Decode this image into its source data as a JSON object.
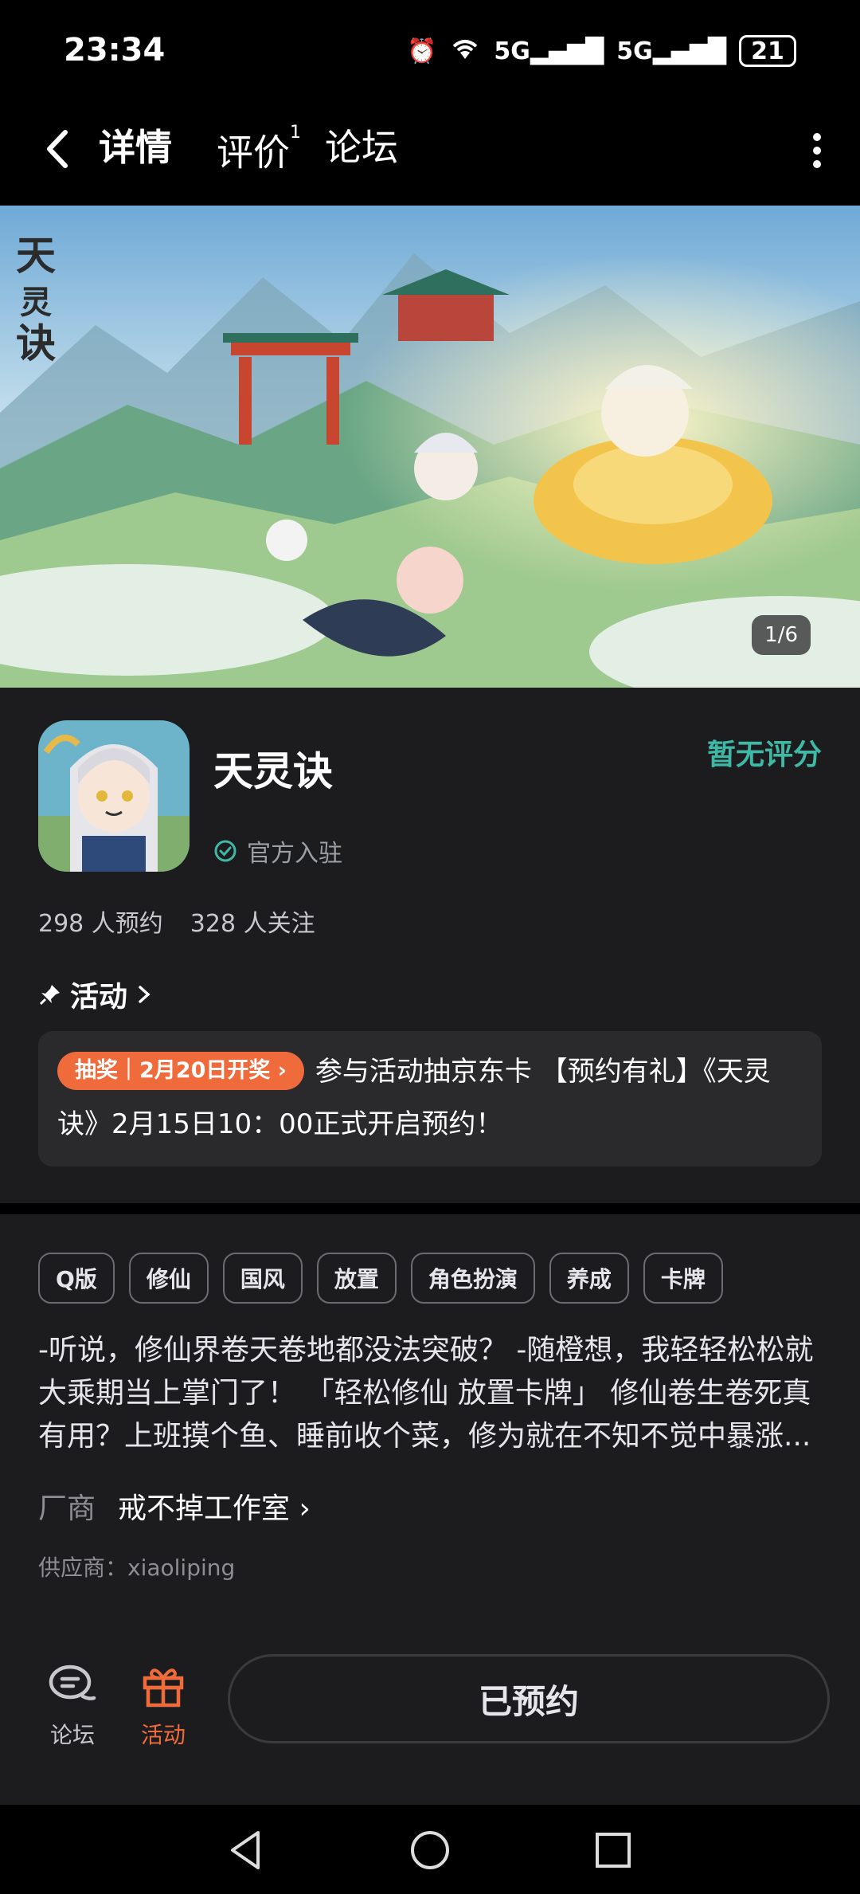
{
  "status": {
    "time": "23:34",
    "net1": "5G",
    "net2": "5G",
    "battery": "21"
  },
  "nav": {
    "tabs": [
      {
        "label": "详情"
      },
      {
        "label": "评价",
        "badge": "1"
      },
      {
        "label": "论坛"
      }
    ]
  },
  "banner": {
    "counter": "1/6",
    "logo_text": "天灵诀"
  },
  "app": {
    "name": "天灵诀",
    "verified_label": "官方入驻",
    "rating": "暂无评分",
    "reservations": "298 人预约",
    "followers": "328 人关注"
  },
  "activity": {
    "title": "活动",
    "badge": "抽奖｜2月20日开奖",
    "text": "参与活动抽京东卡 【预约有礼】《天灵诀》2月15日10：00正式开启预约！"
  },
  "tags": [
    "Q版",
    "修仙",
    "国风",
    "放置",
    "角色扮演",
    "养成",
    "卡牌"
  ],
  "description": "-听说，修仙界卷天卷地都没法突破？ -随橙想，我轻轻松松就大乘期当上掌门了！ 「轻松修仙 放置卡牌」 修仙卷生卷死真有用？上班摸个鱼、睡前收个菜，修为就在不知不觉中暴涨...",
  "vendor": {
    "label": "厂商",
    "name": "戒不掉工作室"
  },
  "supplier": "供应商：xiaoliping",
  "bottom": {
    "forum_label": "论坛",
    "activity_label": "活动",
    "reserve_label": "已预约"
  },
  "colors": {
    "accent": "#3fb8a6",
    "orange": "#f06b3c",
    "background": "#1c1c1e"
  }
}
